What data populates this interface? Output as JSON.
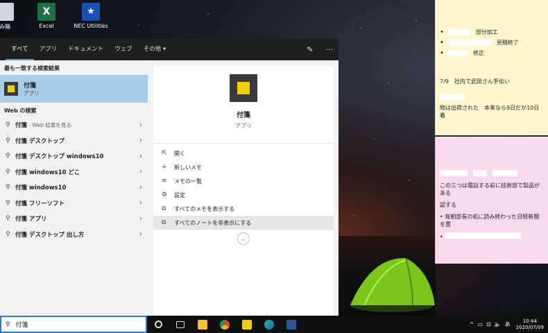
{
  "desktop": {
    "icons": [
      {
        "label": "み箱"
      },
      {
        "label": "Excel"
      },
      {
        "label": "NEC Utilities"
      }
    ]
  },
  "search": {
    "tabs": [
      "すべて",
      "アプリ",
      "ドキュメント",
      "ウェブ",
      "その他 ▾"
    ],
    "best_match_header": "最も一致する検索結果",
    "best_match": {
      "title": "付箋",
      "subtitle": "アプリ"
    },
    "web_header": "Web の検索",
    "web_results": [
      {
        "query": "付箋",
        "suffix": " - Web 結果を見る"
      },
      {
        "query": "付箋 デスクトップ",
        "suffix": ""
      },
      {
        "query": "付箋 デスクトップ windows10",
        "suffix": ""
      },
      {
        "query": "付箋 windows10 どこ",
        "suffix": ""
      },
      {
        "query": "付箋 windows10",
        "suffix": ""
      },
      {
        "query": "付箋 フリーソフト",
        "suffix": ""
      },
      {
        "query": "付箋 アプリ",
        "suffix": ""
      },
      {
        "query": "付箋 デスクトップ 出し方",
        "suffix": ""
      }
    ],
    "detail": {
      "name": "付箋",
      "type": "アプリ",
      "actions": [
        {
          "label": "開く",
          "icon": "open-icon"
        },
        {
          "label": "新しいメモ",
          "icon": "plus-icon"
        },
        {
          "label": "メモの一覧",
          "icon": "list-icon"
        },
        {
          "label": "設定",
          "icon": "gear-icon"
        },
        {
          "label": "すべてのメモを表示する",
          "icon": "show-notes-icon"
        },
        {
          "label": "すべてのノートを非表示にする",
          "icon": "hide-notes-icon"
        }
      ]
    },
    "query_value": "付箋"
  },
  "notes": {
    "yellow": {
      "items": [
        "部分加工",
        "見積終了",
        "修正"
      ],
      "line1": "7/9　社内で武田さん手伝い",
      "line2": "物は出荷された　本来なら9日だが10日着"
    },
    "pink": {
      "line1": "この三つは電話する前に技術部で製品がある",
      "line2": "認する",
      "line3": "毎朝部長の机に読み終わった日経新聞を置"
    }
  },
  "taskbar": {
    "time": "10:44",
    "date": "2020/07/09",
    "ime": "あ"
  },
  "colors": {
    "accent": "#2a7ad6",
    "selected": "#a9cde8",
    "sticky_yellow": "#f5d000"
  }
}
